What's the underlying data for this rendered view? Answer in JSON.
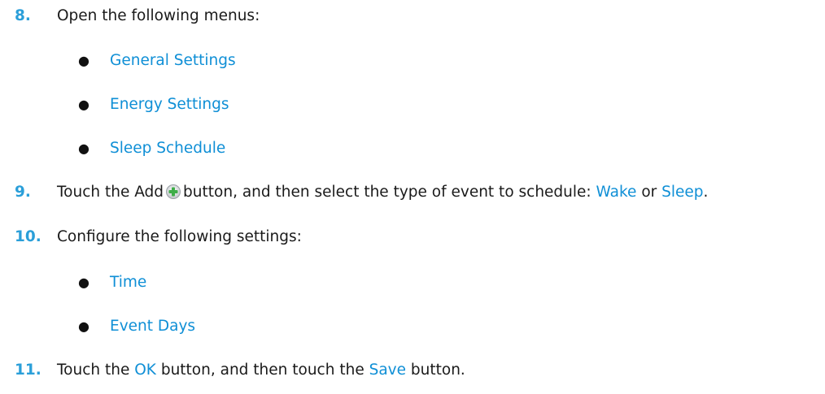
{
  "steps": {
    "s8": {
      "number": "8.",
      "text": "Open the following menus:",
      "bullets": [
        "General Settings",
        "Energy Settings",
        "Sleep Schedule"
      ]
    },
    "s9": {
      "number": "9.",
      "pre": "Touch the Add",
      "icon": "add-icon",
      "mid": "button, and then select the type of event to schedule:",
      "opt1": "Wake",
      "or": "or",
      "opt2": "Sleep",
      "end": "."
    },
    "s10": {
      "number": "10.",
      "text": "Configure the following settings:",
      "bullets": [
        "Time",
        "Event Days"
      ]
    },
    "s11": {
      "number": "11.",
      "pre": "Touch the",
      "ok": "OK",
      "mid": "button, and then touch the",
      "save": "Save",
      "end": "button."
    }
  },
  "colors": {
    "accent": "#2b9fd9",
    "ui_link": "#0f8fd6",
    "text": "#1a1a1a"
  }
}
